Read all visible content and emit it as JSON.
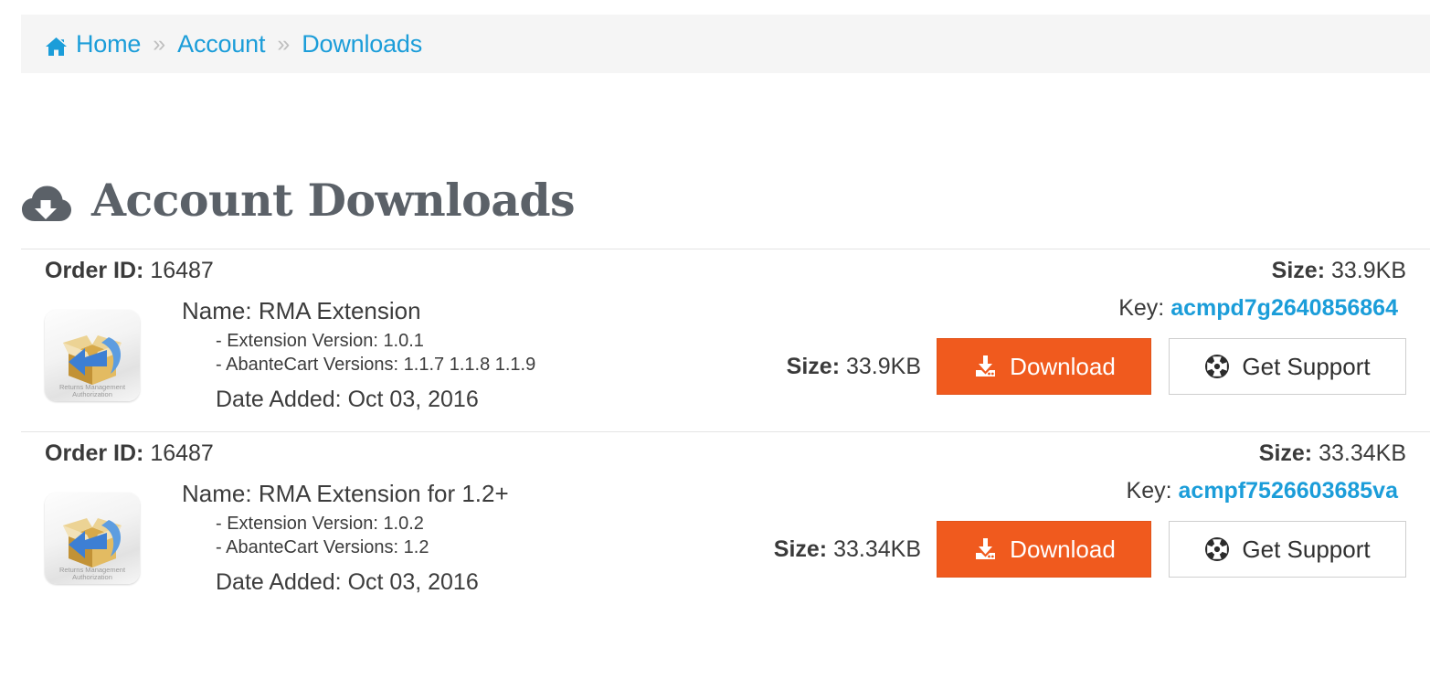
{
  "breadcrumb": {
    "home_icon": "home-icon",
    "items": [
      {
        "label": "Home",
        "icon": "home-icon"
      },
      {
        "label": "Account",
        "icon": null
      },
      {
        "label": "Downloads",
        "icon": null
      }
    ],
    "separator": "»",
    "link_color": "#1b9dd9",
    "bar_background": "#f5f5f5"
  },
  "page": {
    "title": "Account Downloads",
    "title_icon": "cloud-download-icon",
    "title_color": "#5b6168"
  },
  "labels": {
    "order_id": "Order ID:",
    "size": "Size:",
    "key": "Key:",
    "name": "Name:",
    "extension_version": "- Extension Version:",
    "abantecart_versions": "- AbanteCart Versions:",
    "date_added": "Date Added:",
    "download_button": "Download",
    "support_button": "Get Support",
    "download_icon": "download-tray-icon",
    "support_icon": "lifebuoy-icon",
    "product_icon": "rma-extension-icon"
  },
  "colors": {
    "accent_orange": "#f05a1e",
    "link_blue": "#1b9dd9",
    "text_dark": "#3c3c3c",
    "border_gray": "#e4e4e4"
  },
  "orders": [
    {
      "order_id": "16487",
      "size": "33.9KB",
      "key": "acmpd7g2640856864",
      "name": "RMA Extension",
      "extension_version": "1.0.1",
      "abantecart_versions": "1.1.7 1.1.8 1.1.9",
      "date_added": "Oct 03, 2016",
      "item_size": "33.9KB",
      "icon_caption_line1": "Returns Management",
      "icon_caption_line2": "Authorization"
    },
    {
      "order_id": "16487",
      "size": "33.34KB",
      "key": "acmpf7526603685va",
      "name": "RMA Extension for 1.2+",
      "extension_version": "1.0.2",
      "abantecart_versions": "1.2",
      "date_added": "Oct 03, 2016",
      "item_size": "33.34KB",
      "icon_caption_line1": "Returns Management",
      "icon_caption_line2": "Authorization"
    }
  ]
}
